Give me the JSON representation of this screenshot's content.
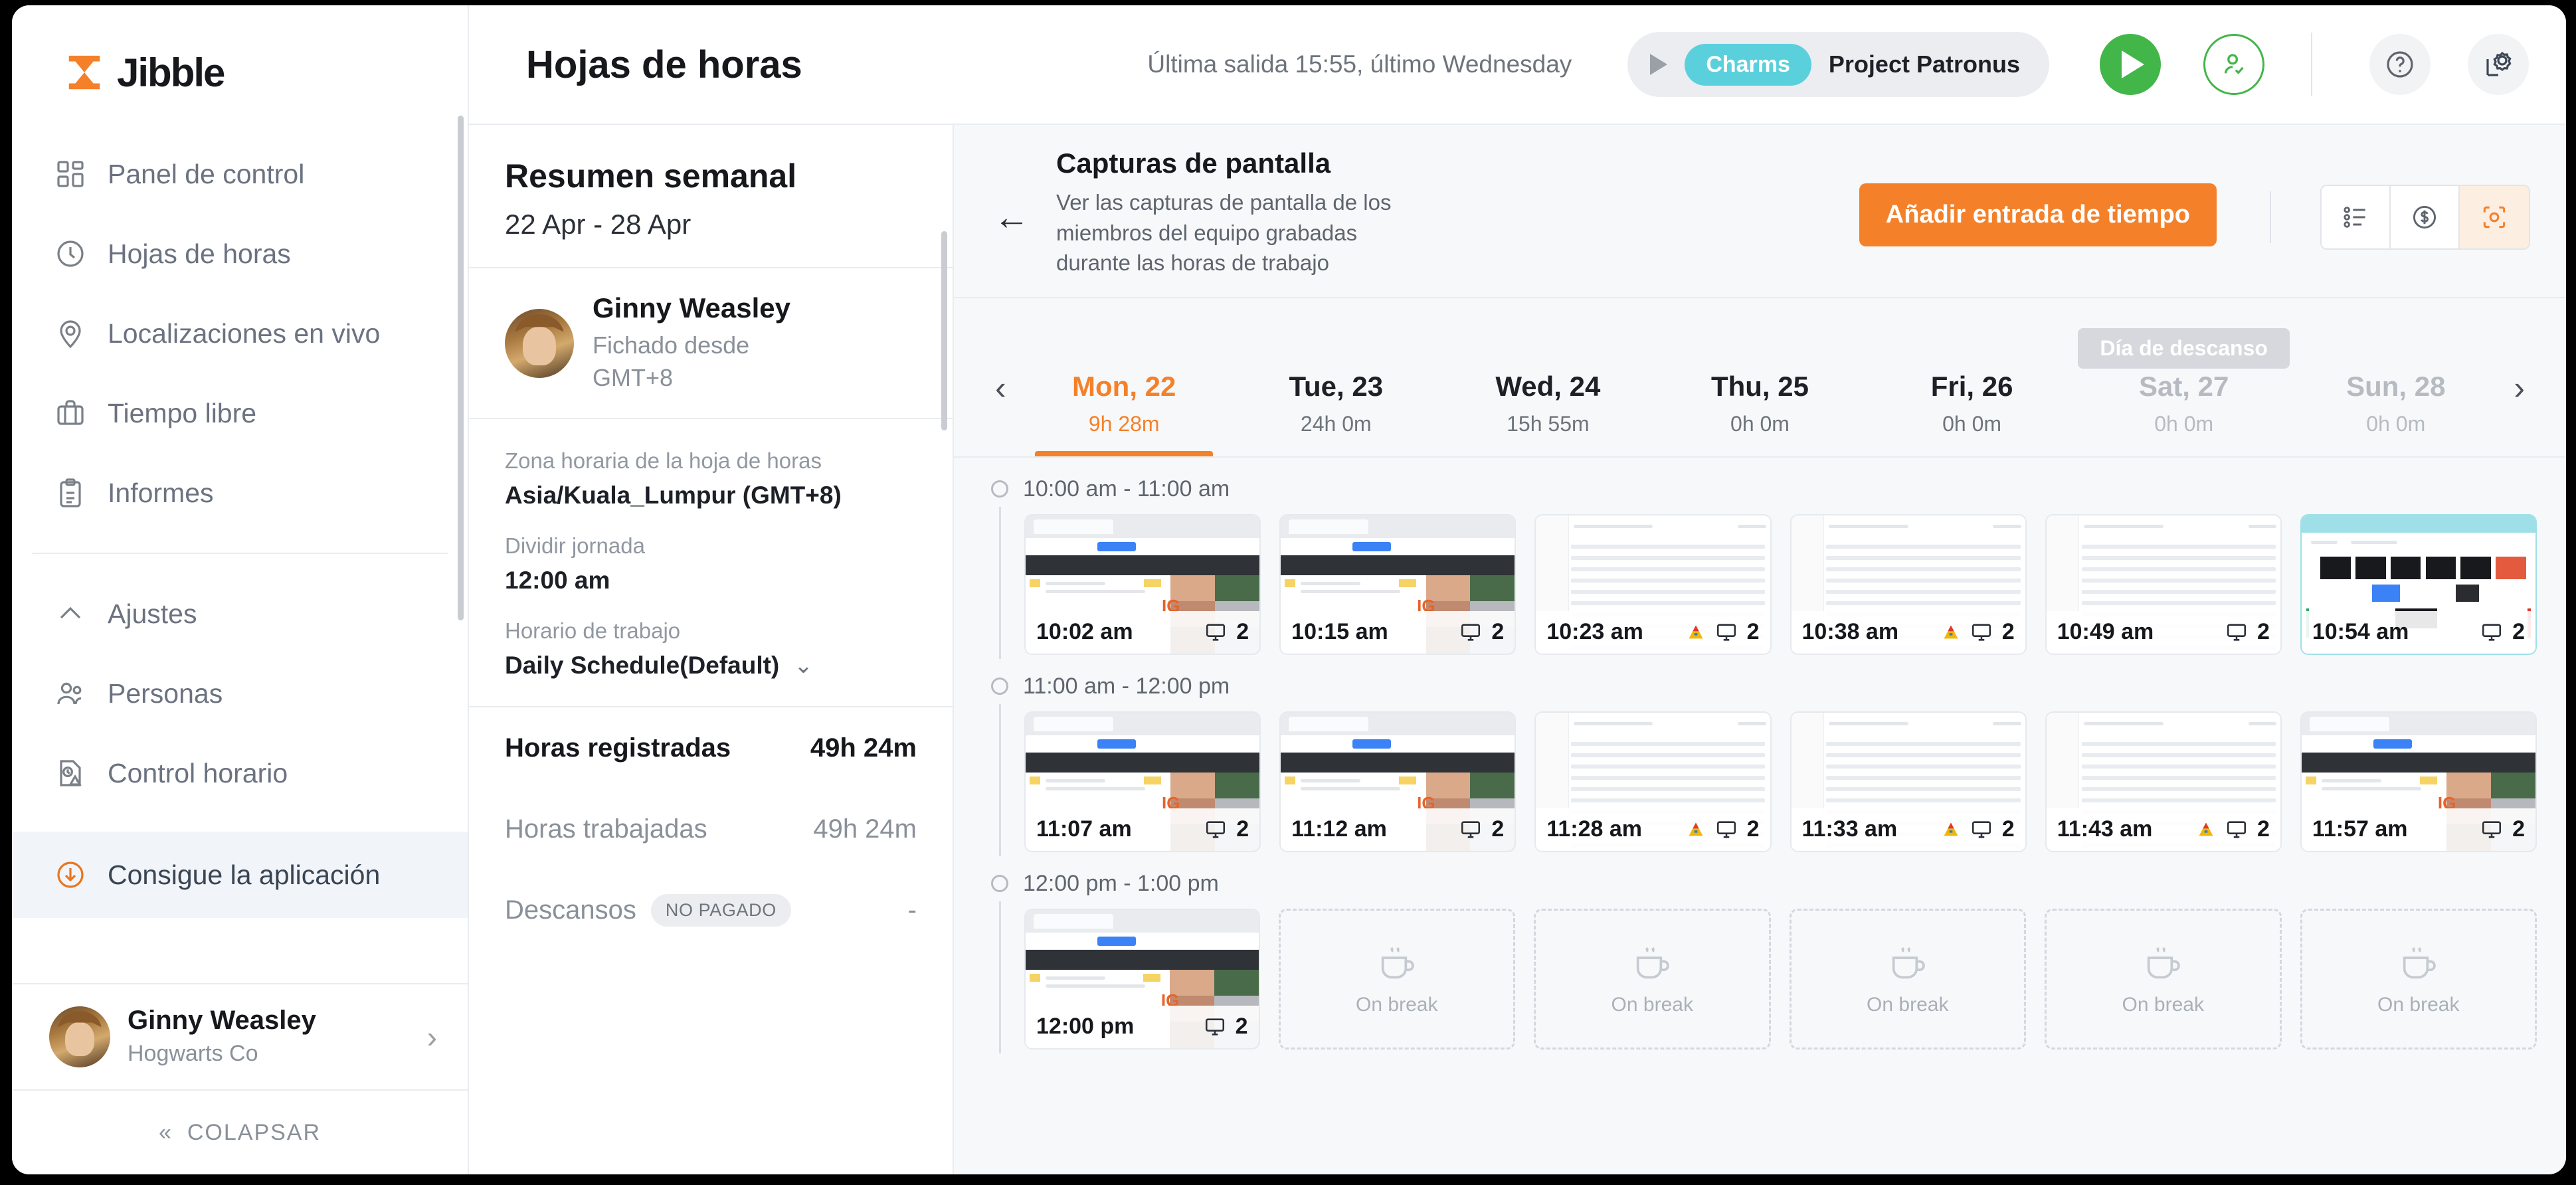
{
  "brand": {
    "name": "Jibble",
    "accent": "#f4812a"
  },
  "sidebar": {
    "items": [
      {
        "label": "Panel de control",
        "icon": "dashboard-icon"
      },
      {
        "label": "Hojas de horas",
        "icon": "clock-icon"
      },
      {
        "label": "Localizaciones en vivo",
        "icon": "map-pin-icon"
      },
      {
        "label": "Tiempo libre",
        "icon": "briefcase-icon"
      },
      {
        "label": "Informes",
        "icon": "clipboard-icon"
      }
    ],
    "items2": [
      {
        "label": "Ajustes",
        "icon": "chevron-up-icon"
      },
      {
        "label": "Personas",
        "icon": "people-icon"
      },
      {
        "label": "Control horario",
        "icon": "time-audit-icon"
      }
    ],
    "get_app": {
      "label": "Consigue la aplicación",
      "icon": "download-icon"
    },
    "user": {
      "name": "Ginny Weasley",
      "org": "Hogwarts Co"
    },
    "collapse": {
      "label": "COLAPSAR",
      "icon": "double-chevron-left-icon"
    }
  },
  "header": {
    "title": "Hojas de horas",
    "last_out": "Última salida 15:55, último Wednesday",
    "tracker": {
      "activity": "Charms",
      "project": "Project Patronus"
    },
    "activity_color": "#5bd0dd"
  },
  "summary": {
    "title": "Resumen semanal",
    "range": "22 Apr - 28 Apr",
    "person": {
      "name": "Ginny Weasley",
      "status_line1": "Fichado desde",
      "status_line2": "GMT+8"
    },
    "fields": [
      {
        "label": "Zona horaria de la hoja de horas",
        "value": "Asia/Kuala_Lumpur (GMT+8)"
      },
      {
        "label": "Dividir jornada",
        "value": "12:00 am"
      },
      {
        "label": "Horario de trabajo",
        "value": "Daily Schedule(Default)"
      }
    ],
    "rows": [
      {
        "label": "Horas registradas",
        "value": "49h 24m",
        "tag": ""
      },
      {
        "label": "Horas trabajadas",
        "value": "49h 24m",
        "tag": ""
      },
      {
        "label": "Descansos",
        "value": "-",
        "tag": "NO PAGADO"
      }
    ]
  },
  "main": {
    "title": "Capturas de pantalla",
    "description": "Ver las capturas de pantalla de los miembros del equipo grabadas durante las horas de trabajo",
    "add_button": "Añadir entrada de tiempo",
    "view_modes": [
      {
        "icon": "list-view-icon",
        "active": false
      },
      {
        "icon": "dollar-view-icon",
        "active": false
      },
      {
        "icon": "screenshot-view-icon",
        "active": true
      }
    ],
    "rest_day_badge": "Día de descanso",
    "days": [
      {
        "name": "Mon, 22",
        "hours": "9h 28m",
        "active": true,
        "off": false
      },
      {
        "name": "Tue, 23",
        "hours": "24h 0m",
        "active": false,
        "off": false
      },
      {
        "name": "Wed, 24",
        "hours": "15h 55m",
        "active": false,
        "off": false
      },
      {
        "name": "Thu, 25",
        "hours": "0h 0m",
        "active": false,
        "off": false
      },
      {
        "name": "Fri, 26",
        "hours": "0h 0m",
        "active": false,
        "off": false
      },
      {
        "name": "Sat, 27",
        "hours": "0h 0m",
        "active": false,
        "off": true,
        "rest": true
      },
      {
        "name": "Sun, 28",
        "hours": "0h 0m",
        "active": false,
        "off": true
      }
    ],
    "groups": [
      {
        "time_range": "10:00 am - 11:00 am",
        "cards": [
          {
            "time": "10:02 am",
            "count": "2",
            "kind": "meeting",
            "warn": false,
            "sel": false
          },
          {
            "time": "10:15 am",
            "count": "2",
            "kind": "meeting",
            "warn": false,
            "sel": false
          },
          {
            "time": "10:23 am",
            "count": "2",
            "kind": "doc",
            "warn": true,
            "sel": false
          },
          {
            "time": "10:38 am",
            "count": "2",
            "kind": "doc",
            "warn": true,
            "sel": false
          },
          {
            "time": "10:49 am",
            "count": "2",
            "kind": "doc",
            "warn": false,
            "sel": false
          },
          {
            "time": "10:54 am",
            "count": "2",
            "kind": "grid",
            "warn": false,
            "sel": true
          }
        ]
      },
      {
        "time_range": "11:00 am - 12:00 pm",
        "cards": [
          {
            "time": "11:07 am",
            "count": "2",
            "kind": "meeting",
            "warn": false,
            "sel": false
          },
          {
            "time": "11:12 am",
            "count": "2",
            "kind": "meeting",
            "warn": false,
            "sel": false
          },
          {
            "time": "11:28 am",
            "count": "2",
            "kind": "doc",
            "warn": true,
            "sel": false
          },
          {
            "time": "11:33 am",
            "count": "2",
            "kind": "doc",
            "warn": true,
            "sel": false
          },
          {
            "time": "11:43 am",
            "count": "2",
            "kind": "doc",
            "warn": true,
            "sel": false
          },
          {
            "time": "11:57 am",
            "count": "2",
            "kind": "meeting",
            "warn": false,
            "sel": false
          }
        ]
      },
      {
        "time_range": "12:00 pm - 1:00 pm",
        "cards": [
          {
            "time": "12:00 pm",
            "count": "2",
            "kind": "meeting",
            "warn": false,
            "sel": false
          },
          {
            "break_label": "On break"
          },
          {
            "break_label": "On break"
          },
          {
            "break_label": "On break"
          },
          {
            "break_label": "On break"
          },
          {
            "break_label": "On break"
          }
        ]
      }
    ]
  }
}
